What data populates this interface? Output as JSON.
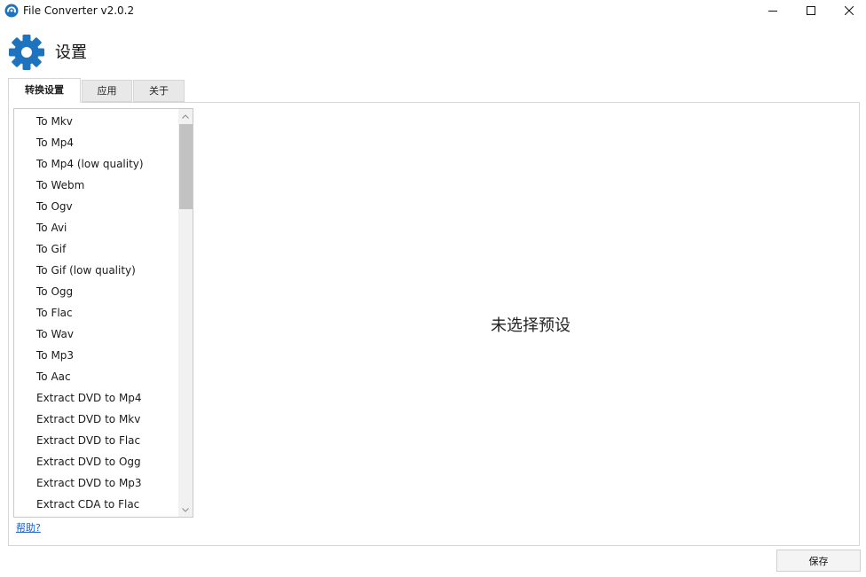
{
  "window": {
    "title": "File Converter v2.0.2",
    "icons": {
      "app": "file-converter-app-icon",
      "minimize": "minimize-icon",
      "maximize": "maximize-icon",
      "close": "close-icon"
    }
  },
  "header": {
    "title": "设置",
    "icon": "gear-icon",
    "accent_color": "#1e73be"
  },
  "tabs": [
    {
      "label": "转换设置",
      "active": true
    },
    {
      "label": "应用",
      "active": false
    },
    {
      "label": "关于",
      "active": false
    }
  ],
  "presets": [
    "To Mkv",
    "To Mp4",
    "To Mp4 (low quality)",
    "To Webm",
    "To Ogv",
    "To Avi",
    "To Gif",
    "To Gif (low quality)",
    "To Ogg",
    "To Flac",
    "To Wav",
    "To Mp3",
    "To Aac",
    "Extract DVD to Mp4",
    "Extract DVD to Mkv",
    "Extract DVD to Flac",
    "Extract DVD to Ogg",
    "Extract DVD to Mp3",
    "Extract CDA to Flac"
  ],
  "help_link": "帮助?",
  "empty_state": "未选择预设",
  "footer": {
    "save_label": "保存"
  }
}
